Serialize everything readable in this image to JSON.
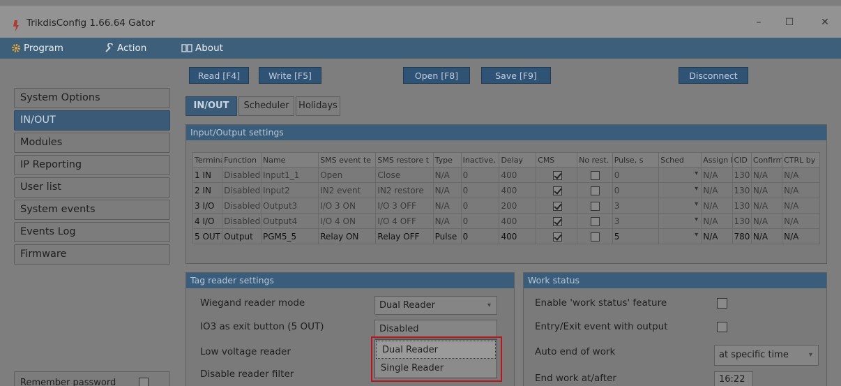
{
  "window": {
    "title": "TrikdisConfig 1.66.64  Gator",
    "minimize": "–",
    "maximize": "☐",
    "close": "✕"
  },
  "menu": {
    "program": "Program",
    "action": "Action",
    "about": "About"
  },
  "toolbar": {
    "read": "Read [F4]",
    "write": "Write [F5]",
    "open": "Open [F8]",
    "save": "Save [F9]",
    "disconnect": "Disconnect"
  },
  "sidebar": {
    "items": [
      {
        "label": "System Options"
      },
      {
        "label": "IN/OUT"
      },
      {
        "label": "Modules"
      },
      {
        "label": "IP Reporting"
      },
      {
        "label": "User list"
      },
      {
        "label": "System events"
      },
      {
        "label": "Events Log"
      },
      {
        "label": "Firmware"
      }
    ],
    "active_index": 1,
    "bottom_label": "Remember password"
  },
  "tabs": [
    "IN/OUT",
    "Scheduler",
    "Holidays"
  ],
  "io_settings": {
    "title": "Input/Output settings",
    "headers": [
      "Termina",
      "Function",
      "Name",
      "SMS event te",
      "SMS restore t",
      "Type",
      "Inactive,",
      "Delay",
      "CMS",
      "No rest.",
      "Pulse, s",
      "Sched",
      "Assign II",
      "CID",
      "Confirm",
      "CTRL by"
    ],
    "rows": [
      {
        "terminal": "1 IN",
        "function": "Disabled",
        "name": "Input1_1",
        "sms_event": "Open",
        "sms_restore": "Close",
        "type": "N/A",
        "inactive": "0",
        "delay": "400",
        "cms": true,
        "no_rest": false,
        "pulse": "0",
        "assign": "N/A",
        "cid": "130",
        "confirm": "N/A",
        "ctrl": "N/A"
      },
      {
        "terminal": "2 IN",
        "function": "Disabled",
        "name": "Input2",
        "sms_event": "IN2 event",
        "sms_restore": "IN2 restore",
        "type": "N/A",
        "inactive": "0",
        "delay": "400",
        "cms": true,
        "no_rest": false,
        "pulse": "0",
        "assign": "N/A",
        "cid": "130",
        "confirm": "N/A",
        "ctrl": "N/A"
      },
      {
        "terminal": "3 I/O",
        "function": "Disabled",
        "name": "Output3",
        "sms_event": "I/O 3 ON",
        "sms_restore": "I/O 3 OFF",
        "type": "N/A",
        "inactive": "0",
        "delay": "200",
        "cms": true,
        "no_rest": false,
        "pulse": "3",
        "assign": "N/A",
        "cid": "130",
        "confirm": "N/A",
        "ctrl": "N/A"
      },
      {
        "terminal": "4 I/O",
        "function": "Disabled",
        "name": "Output4",
        "sms_event": "I/O 4 ON",
        "sms_restore": "I/O 4 OFF",
        "type": "N/A",
        "inactive": "0",
        "delay": "400",
        "cms": true,
        "no_rest": false,
        "pulse": "3",
        "assign": "N/A",
        "cid": "130",
        "confirm": "N/A",
        "ctrl": "N/A"
      },
      {
        "terminal": "5 OUT",
        "function": "Output",
        "name": "PGM5_5",
        "sms_event": "Relay ON",
        "sms_restore": "Relay OFF",
        "type": "Pulse",
        "inactive": "0",
        "delay": "400",
        "cms": true,
        "no_rest": false,
        "pulse": "5",
        "assign": "N/A",
        "cid": "780",
        "confirm": "N/A",
        "ctrl": "N/A"
      }
    ]
  },
  "tag_reader": {
    "title": "Tag reader settings",
    "labels": [
      "Wiegand reader mode",
      "IO3 as exit button (5 OUT)",
      "Low voltage reader",
      "Disable reader filter"
    ],
    "wiegand_value": "Dual Reader",
    "exit_button_value": "Disabled",
    "dropdown_options": [
      "Dual Reader",
      "Single Reader"
    ],
    "dropdown_selected": "Dual Reader"
  },
  "work_status": {
    "title": "Work status",
    "labels": [
      "Enable 'work status' feature",
      "Entry/Exit event with output",
      "Auto end of work",
      "End work at/after"
    ],
    "enable_checked": false,
    "entry_exit_checked": false,
    "auto_end_value": "at specific time",
    "end_time_value": "16:22"
  },
  "colors": {
    "accent": "#3b5d7c",
    "highlight_box": "#c0141b"
  }
}
